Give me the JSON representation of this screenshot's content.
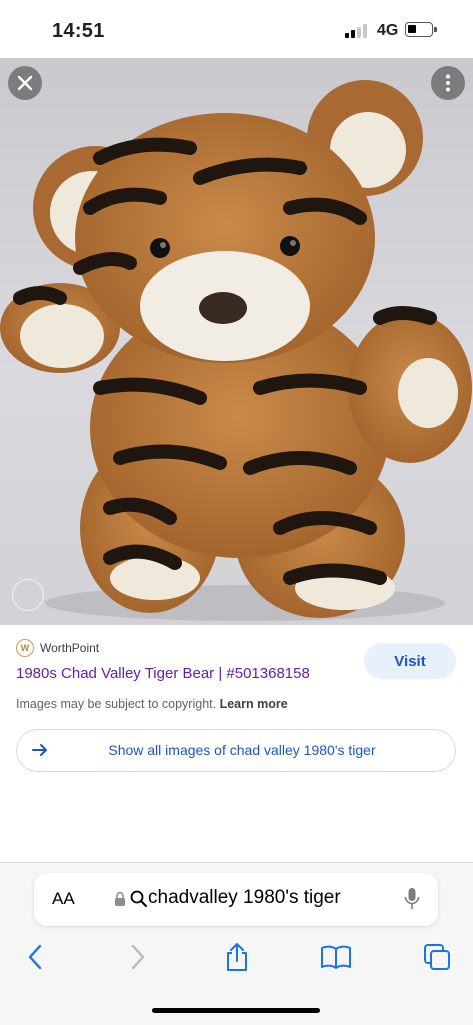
{
  "status_bar": {
    "time": "14:51",
    "network": "4G",
    "signal_bars_on": 2,
    "signal_bars_total": 4,
    "battery_level": 0.3
  },
  "viewer": {
    "close_icon": "close-icon",
    "more_icon": "more-vertical-icon",
    "image_subject": "tiger-plush-bear"
  },
  "result": {
    "source_name": "WorthPoint",
    "source_logo_letter": "W",
    "title": "1980s Chad Valley Tiger Bear | #501368158",
    "visit_label": "Visit",
    "copyright_text": "Images may be subject to copyright.",
    "learn_more": "Learn more",
    "show_all_label": "Show all images of chad valley 1980's tiger"
  },
  "toolbar": {
    "aa_label": "AA",
    "url_text": "chadvalley 1980's tiger",
    "icons": [
      "lock-icon",
      "search-icon",
      "microphone-icon",
      "back-icon",
      "forward-icon",
      "share-icon",
      "bookmarks-icon",
      "tabs-icon"
    ]
  },
  "colors": {
    "link_visited": "#681da8",
    "accent_blue": "#1a56c8",
    "visit_bg": "#e8f0fe"
  }
}
